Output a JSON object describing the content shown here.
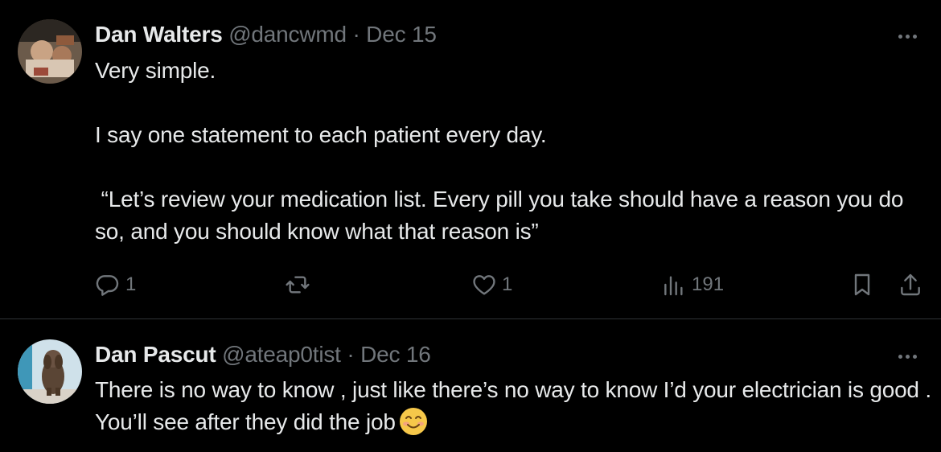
{
  "tweets": [
    {
      "author": "Dan Walters",
      "handle": "@dancwmd",
      "separator": "·",
      "date": "Dec 15",
      "text": "Very simple.\n\nI say one statement to each patient every day.\n\n “Let’s review your medication list. Every pill you take should have a reason you do so, and you should know what that reason is”",
      "actions": {
        "reply_count": "1",
        "retweet_count": "",
        "like_count": "1",
        "views_count": "191"
      },
      "icons": [
        "reply-icon",
        "retweet-icon",
        "like-icon",
        "views-icon",
        "bookmark-icon",
        "share-icon",
        "more-icon"
      ]
    },
    {
      "author": "Dan Pascut",
      "handle": "@ateap0tist",
      "separator": "·",
      "date": "Dec 16",
      "text": "There is no way to know , just like there’s no way to know I’d your electrician is good . You’ll see after they did the job",
      "emoji": "smiling-face-icon",
      "icons": [
        "more-icon"
      ]
    }
  ],
  "colors": {
    "background": "#000000",
    "text": "#e7e9ea",
    "secondary": "#71767b",
    "divider": "#2f3336"
  }
}
